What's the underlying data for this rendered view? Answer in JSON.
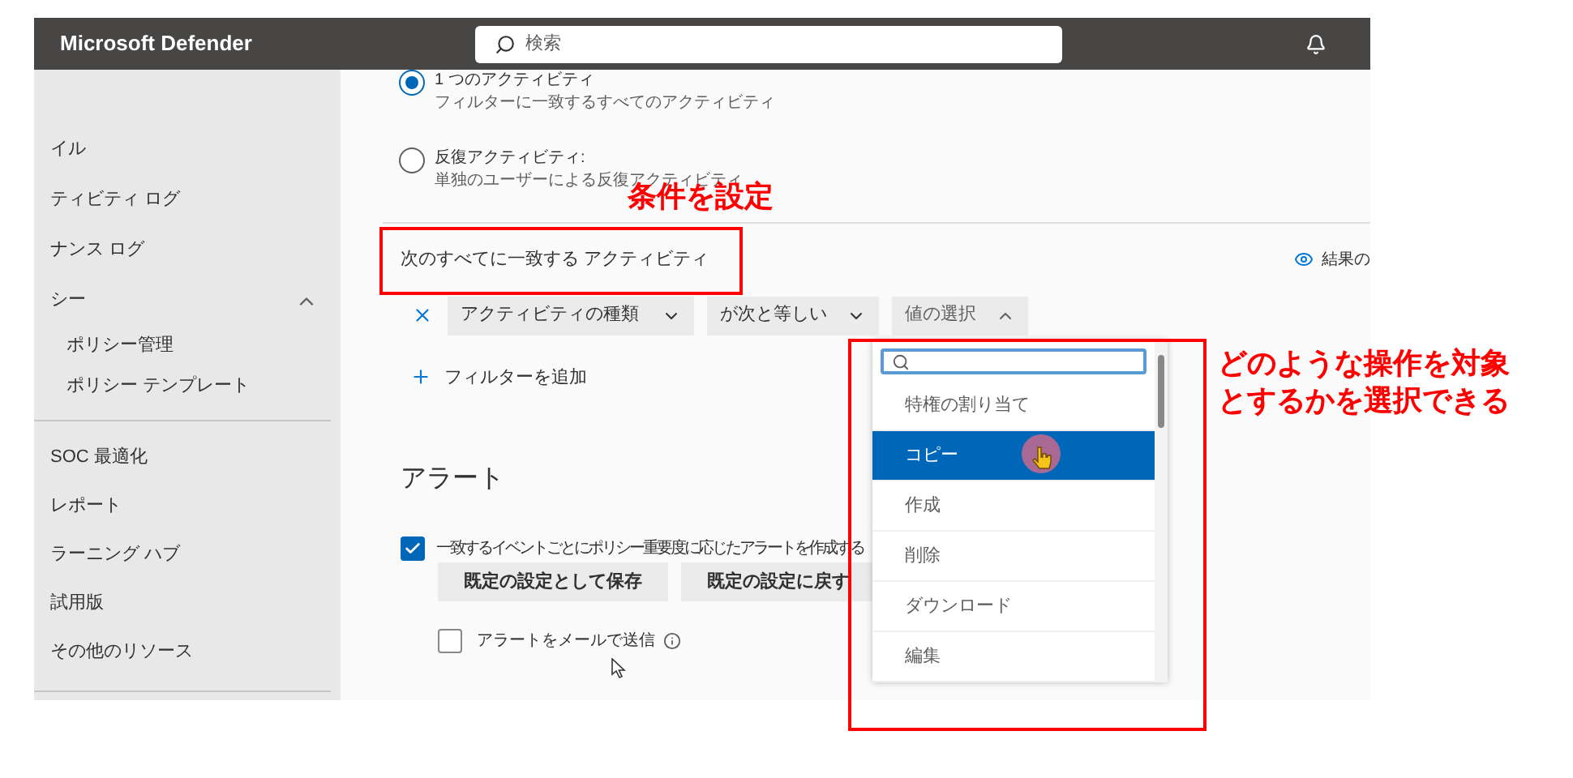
{
  "header": {
    "title": "Microsoft Defender",
    "search": {
      "placeholder": "検索"
    }
  },
  "sidebar": {
    "items": [
      {
        "label": "イル"
      },
      {
        "label": "ティビティ ログ"
      },
      {
        "label": "ナンス ログ"
      },
      {
        "label": "シー",
        "expanded": true,
        "children": [
          {
            "label": "ポリシー管理"
          },
          {
            "label": "ポリシー テンプレート"
          }
        ]
      },
      {
        "label": "SOC 最適化"
      },
      {
        "label": "レポート"
      },
      {
        "label": "ラーニング ハブ"
      },
      {
        "label": "試用版"
      },
      {
        "label": "その他のリソース"
      }
    ]
  },
  "activity_options": [
    {
      "label": "1 つのアクティビティ",
      "description": "フィルターに一致するすべてのアクティビティ",
      "selected": true
    },
    {
      "label": "反復アクティビティ:",
      "description": "単独のユーザーによる反復アクティビティ",
      "selected": false
    }
  ],
  "conditions": {
    "heading": "次のすべてに一致する アクティビティ",
    "preview_link": "結果の",
    "filters": [
      {
        "field": "アクティビティの種類",
        "operator": "が次と等しい",
        "value": "値の選択",
        "expanded": true
      }
    ],
    "add_filter": "フィルターを追加"
  },
  "alerts": {
    "heading": "アラート",
    "create_alert": {
      "label": "一致するイベントごとにポリシー重要度に応じたアラートを作成する",
      "checked": true
    },
    "buttons": [
      "既定の設定として保存",
      "既定の設定に戻す"
    ],
    "email_alert": {
      "label": "アラートをメールで送信",
      "checked": false
    }
  },
  "value_dropdown": {
    "options": [
      {
        "label": "特権の割り当て",
        "selected": false
      },
      {
        "label": "コピー",
        "selected": true
      },
      {
        "label": "作成",
        "selected": false
      },
      {
        "label": "削除",
        "selected": false
      },
      {
        "label": "ダウンロード",
        "selected": false
      },
      {
        "label": "編集",
        "selected": false
      }
    ]
  },
  "annotations": [
    {
      "text": "条件を設定"
    },
    {
      "lines": [
        "どのような操作を対象",
        "とするかを選択できる"
      ]
    }
  ]
}
